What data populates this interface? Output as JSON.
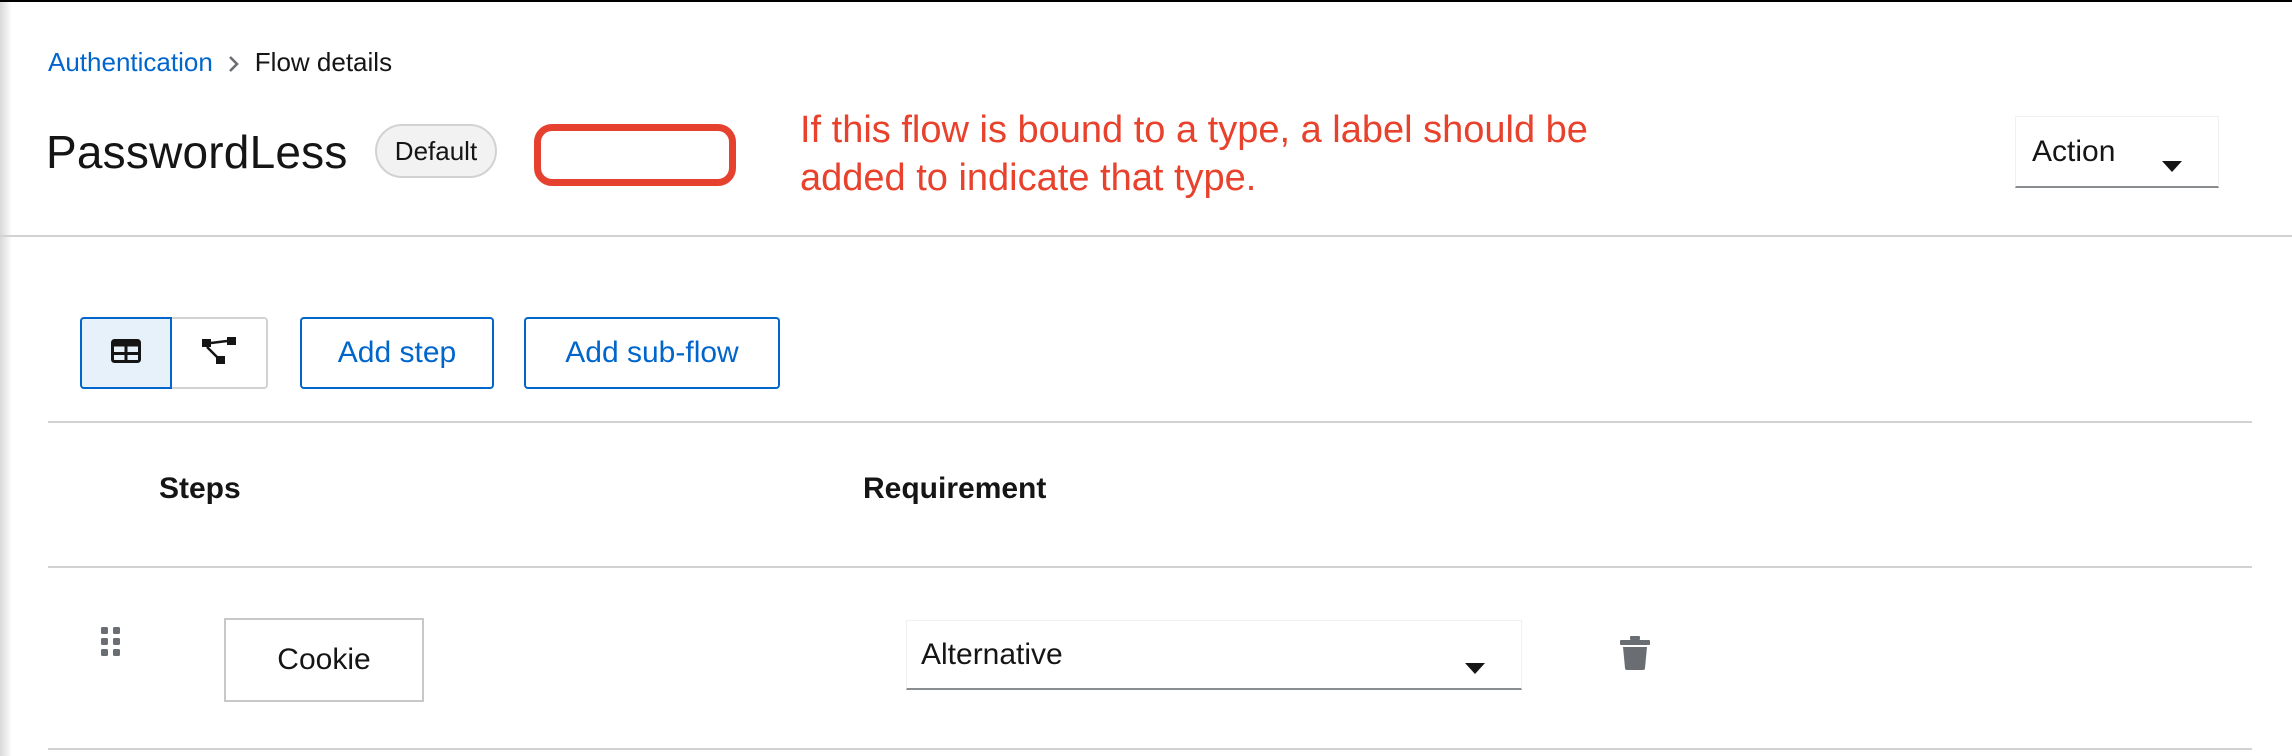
{
  "breadcrumb": {
    "parent": "Authentication",
    "current": "Flow details"
  },
  "header": {
    "title": "PasswordLess",
    "badge": "Default",
    "action_label": "Action"
  },
  "annotation": {
    "text": "If this flow is bound to a type, a label should be added to indicate that type.",
    "color": "#e8412c"
  },
  "toolbar": {
    "add_step": "Add step",
    "add_subflow": "Add sub-flow",
    "view_toggle": [
      "table-view-icon",
      "diagram-view-icon"
    ]
  },
  "table": {
    "columns": [
      "Steps",
      "Requirement"
    ],
    "rows": [
      {
        "step": "Cookie",
        "requirement": "Alternative"
      }
    ]
  },
  "colors": {
    "link": "#0066cc",
    "annotation": "#e6412f",
    "border": "#d2d2d2"
  }
}
